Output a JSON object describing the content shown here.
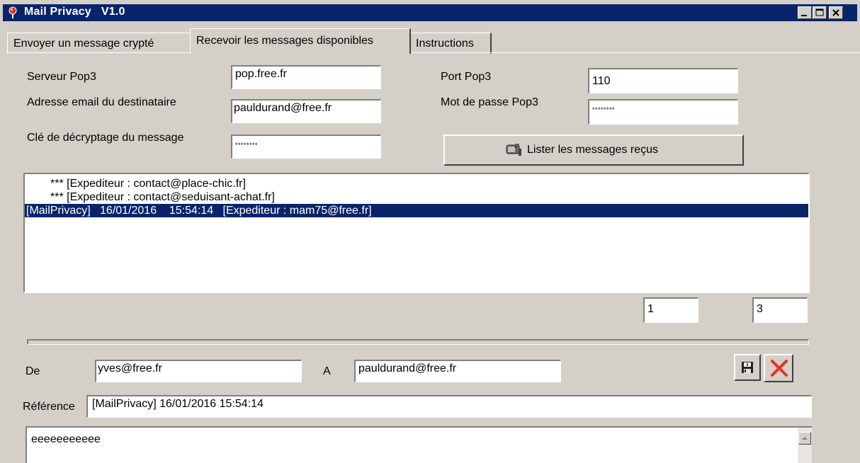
{
  "window": {
    "title": "Mail Privacy   V1.0",
    "icon": "pin-icon"
  },
  "tabs": [
    {
      "label": "Envoyer un message crypté",
      "active": false
    },
    {
      "label": "Recevoir les messages disponibles",
      "active": true
    },
    {
      "label": "Instructions",
      "active": false
    }
  ],
  "form": {
    "server_label": "Serveur Pop3",
    "server_value": "pop.free.fr",
    "email_label": "Adresse email du destinataire",
    "email_value": "pauldurand@free.fr",
    "key_label": "Clé de décryptage du message",
    "key_value": "********",
    "port_label": "Port Pop3",
    "port_value": "110",
    "password_label": "Mot de passe Pop3",
    "password_value": "********",
    "list_button_label": "Lister les messages reçus",
    "list_button_icon": "mailbox-icon"
  },
  "messages": [
    "*** [Expediteur : contact@place-chic.fr]",
    "*** [Expediteur : contact@seduisant-achat.fr]",
    "[MailPrivacy]   16/01/2016    15:54:14   [Expediteur : mam75@free.fr]"
  ],
  "selected_message_index": 2,
  "counters": {
    "current": "1",
    "total": "3"
  },
  "detail": {
    "from_label": "De",
    "from_value": "yves@free.fr",
    "to_label": "A",
    "to_value": "pauldurand@free.fr",
    "reference_label": "Référence",
    "reference_value": "[MailPrivacy]   16/01/2016    15:54:14",
    "body": "eeeeeeeeeee",
    "save_icon": "floppy-disk-icon",
    "delete_icon": "red-x-icon"
  },
  "colors": {
    "title_bar": "#08246b",
    "selection": "#0a246a",
    "face": "#d4d0c8",
    "delete_red": "#e8321e"
  }
}
